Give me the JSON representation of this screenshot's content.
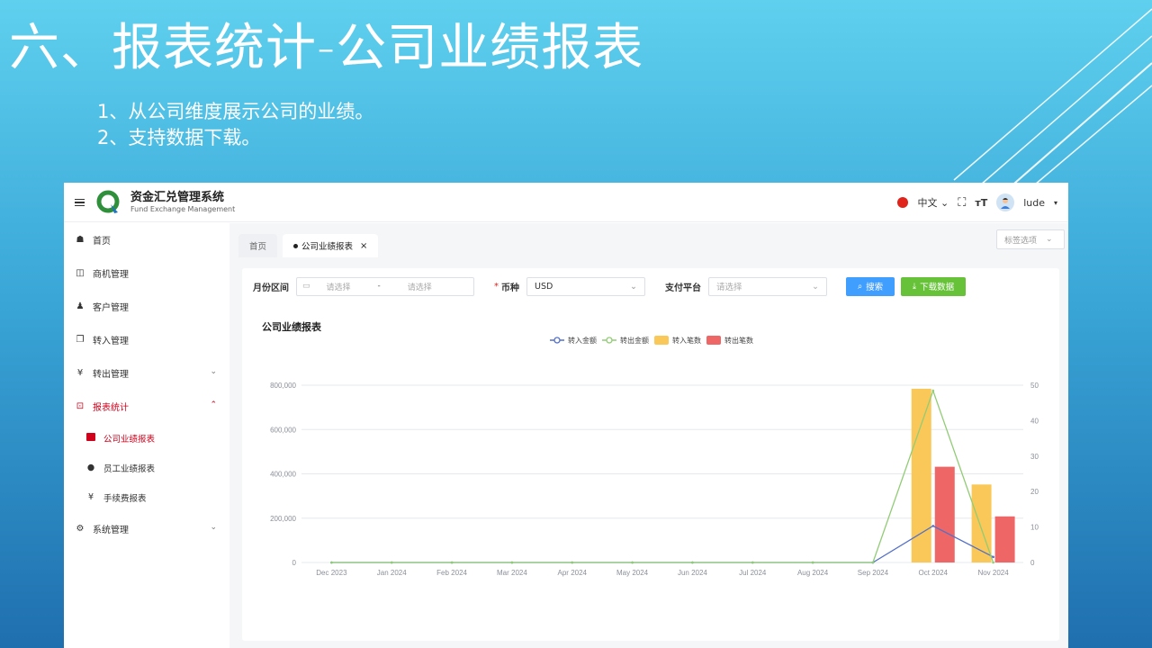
{
  "slide": {
    "title": "六、报表统计-公司业绩报表",
    "points": [
      "1、从公司维度展示公司的业绩。",
      "2、支持数据下载。"
    ]
  },
  "header": {
    "brand_cn": "资金汇兑管理系统",
    "brand_en": "Fund Exchange Management",
    "language": "中文",
    "username": "lude"
  },
  "sidebar": {
    "items": [
      {
        "label": "首页",
        "icon": "dashboard-icon"
      },
      {
        "label": "商机管理",
        "icon": "book-icon"
      },
      {
        "label": "客户管理",
        "icon": "users-icon"
      },
      {
        "label": "转入管理",
        "icon": "copy-icon"
      },
      {
        "label": "转出管理",
        "icon": "yen-icon"
      },
      {
        "label": "报表统计",
        "icon": "report-icon"
      },
      {
        "label": "系统管理",
        "icon": "gear-icon"
      }
    ],
    "sub_items": [
      {
        "label": "公司业绩报表",
        "icon": "calendar-icon"
      },
      {
        "label": "员工业绩报表",
        "icon": "user-icon"
      },
      {
        "label": "手续费报表",
        "icon": "yen-icon"
      }
    ]
  },
  "tabs": {
    "home": "首页",
    "current": "公司业绩报表",
    "options": "标签选项"
  },
  "filters": {
    "month_label": "月份区间",
    "start_placeholder": "请选择",
    "separator": "-",
    "end_placeholder": "请选择",
    "currency_label": "币种",
    "currency_required": "*",
    "currency_value": "USD",
    "platform_label": "支付平台",
    "platform_placeholder": "请选择",
    "search_button": "搜索",
    "download_button": "下载数据"
  },
  "chart_title": "公司业绩报表",
  "chart_data": {
    "type": "bar",
    "categories": [
      "Dec 2023",
      "Jan 2024",
      "Feb 2024",
      "Mar 2024",
      "Apr 2024",
      "May 2024",
      "Jun 2024",
      "Jul 2024",
      "Aug 2024",
      "Sep 2024",
      "Oct 2024",
      "Nov 2024"
    ],
    "y_left": {
      "min": 0,
      "max": 800000,
      "ticks": [
        "0",
        "200,000",
        "400,000",
        "600,000",
        "800,000"
      ]
    },
    "y_right": {
      "min": 0,
      "max": 50,
      "ticks": [
        "0",
        "10",
        "20",
        "30",
        "40",
        "50"
      ]
    },
    "legend_placement": "top-center",
    "series": [
      {
        "name": "转入金额",
        "kind": "line",
        "axis": "left",
        "color": "#5470c6",
        "values": [
          0,
          0,
          0,
          0,
          0,
          0,
          0,
          0,
          0,
          0,
          165000,
          25000
        ]
      },
      {
        "name": "转出金额",
        "kind": "line",
        "axis": "left",
        "color": "#91cc75",
        "values": [
          0,
          0,
          0,
          0,
          0,
          0,
          0,
          0,
          0,
          0,
          775000,
          0
        ]
      },
      {
        "name": "转入笔数",
        "kind": "bar",
        "axis": "right",
        "color": "#fac858",
        "values": [
          0,
          0,
          0,
          0,
          0,
          0,
          0,
          0,
          0,
          0,
          49,
          22
        ]
      },
      {
        "name": "转出笔数",
        "kind": "bar",
        "axis": "right",
        "color": "#ee6666",
        "values": [
          0,
          0,
          0,
          0,
          0,
          0,
          0,
          0,
          0,
          0,
          27,
          13
        ]
      }
    ]
  }
}
